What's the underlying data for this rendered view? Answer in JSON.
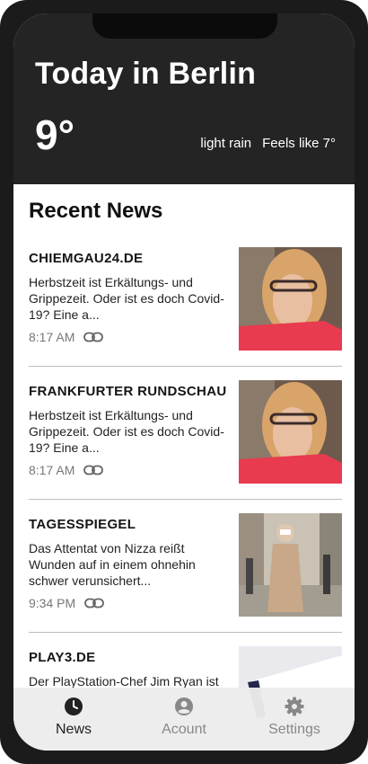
{
  "weather": {
    "title": "Today in Berlin",
    "temperature": "9°",
    "condition": "light rain",
    "feels_like": "Feels like 7°"
  },
  "news": {
    "heading": "Recent News",
    "items": [
      {
        "source": "CHIEMGAU24.DE",
        "summary": "Herbstzeit ist Erkältungs- und Grippezeit. Oder ist es doch Covid-19? Eine a...",
        "time": "8:17 AM",
        "icon": "link-icon"
      },
      {
        "source": "FRANKFURTER RUNDSCHAU",
        "summary": "Herbstzeit ist Erkältungs- und Grippezeit. Oder ist es doch Covid-19? Eine a...",
        "time": "8:17 AM",
        "icon": "link-icon"
      },
      {
        "source": "TAGESSPIEGEL",
        "summary": "Das Attentat von Nizza reißt Wunden auf in einem ohnehin schwer verunsichert...",
        "time": "9:34 PM",
        "icon": "link-icon"
      },
      {
        "source": "PLAY3.DE",
        "summary": "Der PlayStation-Chef Jim Ryan ist",
        "time": "",
        "icon": "link-icon"
      }
    ]
  },
  "tabbar": {
    "tabs": [
      {
        "label": "News",
        "icon": "clock-icon",
        "active": true
      },
      {
        "label": "Acount",
        "icon": "account-icon",
        "active": false
      },
      {
        "label": "Settings",
        "icon": "gear-icon",
        "active": false
      }
    ]
  },
  "colors": {
    "header_bg": "#242424",
    "frame": "#1b1b1b",
    "text_dark": "#151515",
    "text_muted": "#777777",
    "tabbar_bg": "#ececec"
  }
}
